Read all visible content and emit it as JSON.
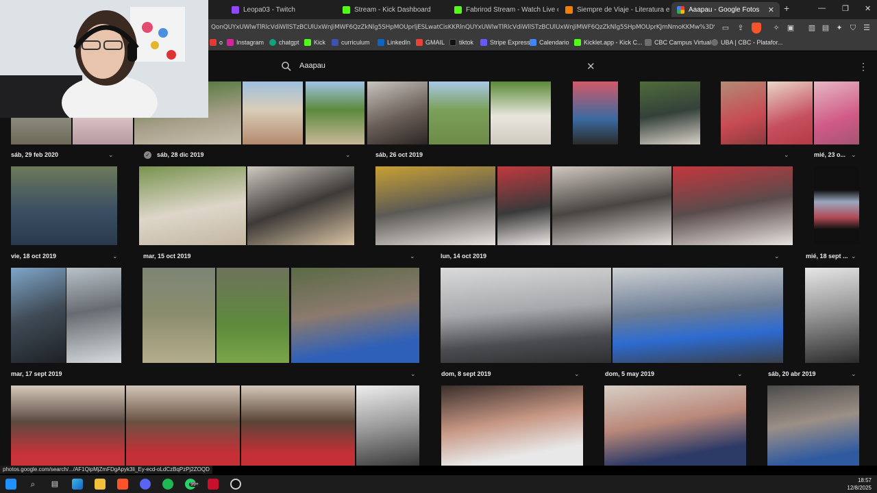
{
  "browser": {
    "tabs": [
      {
        "title": "Leopa03 - Twitch",
        "icon": "twitch-icon",
        "color": "#9146ff"
      },
      {
        "title": "Stream - Kick Dashboard",
        "icon": "kick-icon",
        "color": "#53fc18"
      },
      {
        "title": "Fabrirod Stream - Watch Live on Kick",
        "icon": "kick-icon",
        "color": "#53fc18"
      },
      {
        "title": "Siempre de Viaje - Literatura en p r o",
        "icon": "blogger-icon",
        "color": "#f57d00"
      },
      {
        "title": "Aaapau - Google Fotos",
        "icon": "google-photos-icon",
        "color": "#4285f4"
      }
    ],
    "url": "QonQUYxUWlwTlRlcVdiWllSTzBCUlUxWnJiMWF6QzZkNlg5SHpMOUprljESLwatCisKKRlnQUYxUWlwTlRlcVdiWllSTzBCUlUxWnJiMWF6QzZkNlg5SHpMOUprKJmNmoKKMw%3D%3D",
    "bookmarks": [
      {
        "label": "o",
        "color": "#e53935"
      },
      {
        "label": "Instagram",
        "color": "#d6249f"
      },
      {
        "label": "chatgpt",
        "color": "#10a37f"
      },
      {
        "label": "Kick",
        "color": "#53fc18"
      },
      {
        "label": "curriculum",
        "color": "#3f51b5"
      },
      {
        "label": "LinkedIn",
        "color": "#0a66c2"
      },
      {
        "label": "GMAIL",
        "color": "#ea4335"
      },
      {
        "label": "tiktok",
        "color": "#111111"
      },
      {
        "label": "Stripe Express",
        "color": "#635bff"
      },
      {
        "label": "Calendario",
        "color": "#4285f4"
      },
      {
        "label": "Kicklet.app - Kick C...",
        "color": "#53fc18"
      },
      {
        "label": "CBC Campus Virtual",
        "color": "#6d6d6d"
      },
      {
        "label": "UBA | CBC - Platafor...",
        "color": "#6d6d6d"
      }
    ],
    "status_url": "photos.google.com/search/.../AF1QipMjZmFDgApyk3li_Ey-ecd-oLdCzBqPzPj2ZOQD"
  },
  "search": {
    "query": "Aaapau"
  },
  "groups": [
    {
      "date": "sáb, 29 feb 2020"
    },
    {
      "date": "sáb, 28 dic 2019"
    },
    {
      "date": "sáb, 26 oct 2019"
    },
    {
      "date": "mié, 23 o..."
    },
    {
      "date": "vie, 18 oct 2019"
    },
    {
      "date": "mar, 15 oct 2019"
    },
    {
      "date": "lun, 14 oct 2019"
    },
    {
      "date": "mié, 18 sept ..."
    },
    {
      "date": "mar, 17 sept 2019"
    },
    {
      "date": "dom, 8 sept 2019"
    },
    {
      "date": "dom, 5 may 2019"
    },
    {
      "date": "sáb, 20 abr 2019"
    }
  ],
  "taskbar": {
    "badge": "99+",
    "time": "18:57",
    "date": "12/8/2025"
  },
  "colors": {
    "page_bg": "#111111",
    "chrome_bg": "#3a3a3a",
    "tabstrip_bg": "#1f1f1f"
  }
}
